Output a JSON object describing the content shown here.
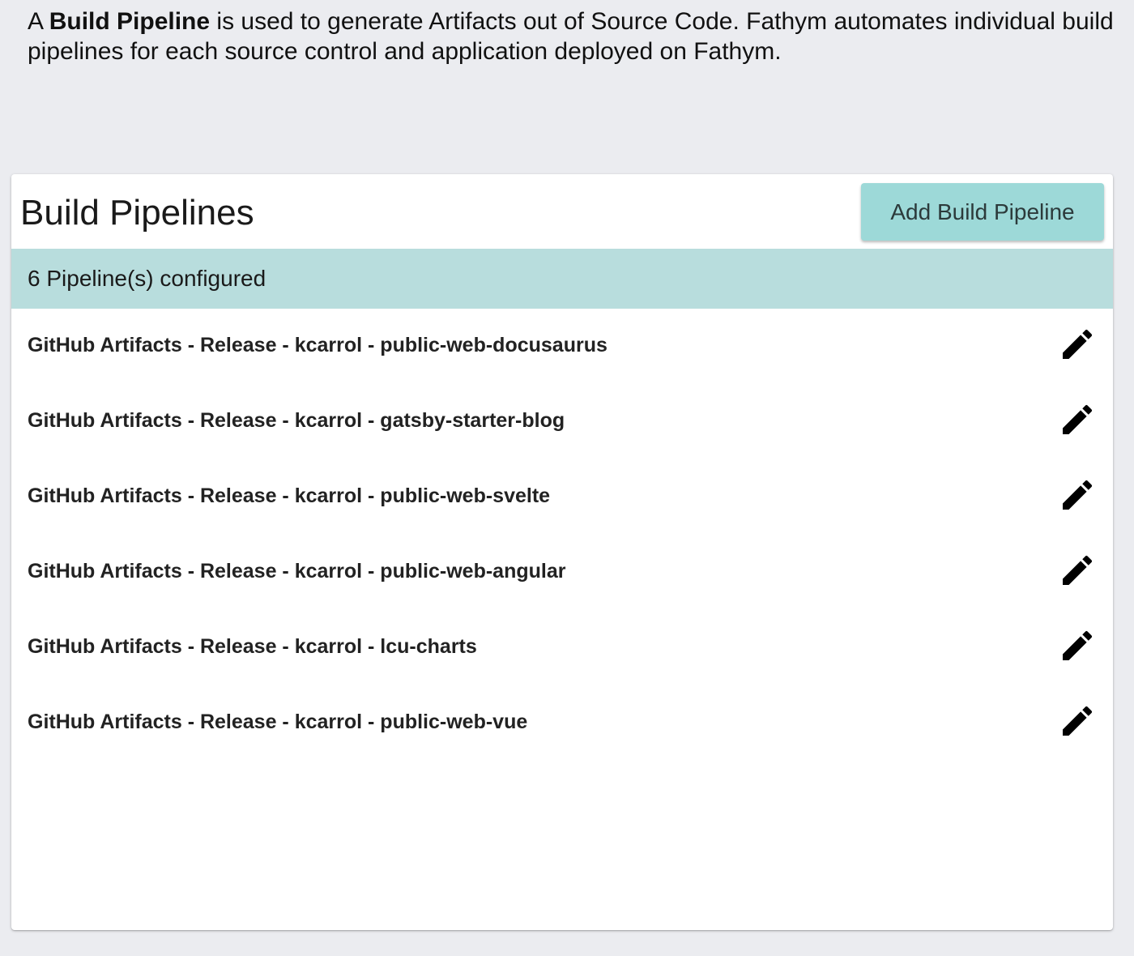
{
  "intro": {
    "prefix": "A ",
    "bold_term": "Build Pipeline",
    "suffix": " is used to generate Artifacts out of Source Code. Fathym automates individual build pipelines for each source control and application deployed on Fathym."
  },
  "card": {
    "title": "Build Pipelines",
    "add_button_label": "Add Build Pipeline",
    "status_text": "6 Pipeline(s) configured"
  },
  "pipelines": [
    {
      "name": "GitHub Artifacts - Release - kcarrol - public-web-docusaurus",
      "icon": "pencil-edit-icon"
    },
    {
      "name": "GitHub Artifacts - Release - kcarrol - gatsby-starter-blog",
      "icon": "pencil-edit-icon"
    },
    {
      "name": "GitHub Artifacts - Release - kcarrol - public-web-svelte",
      "icon": "pencil-edit-icon"
    },
    {
      "name": "GitHub Artifacts - Release - kcarrol - public-web-angular",
      "icon": "pencil-edit-icon"
    },
    {
      "name": "GitHub Artifacts - Release - kcarrol - lcu-charts",
      "icon": "pencil-edit-icon"
    },
    {
      "name": "GitHub Artifacts - Release - kcarrol - public-web-vue",
      "icon": "pencil-edit-icon"
    }
  ],
  "colors": {
    "page_background": "#ebecf0",
    "button_background": "#9dd9d8",
    "status_bar_background": "#b8dddd",
    "card_background": "#ffffff"
  }
}
